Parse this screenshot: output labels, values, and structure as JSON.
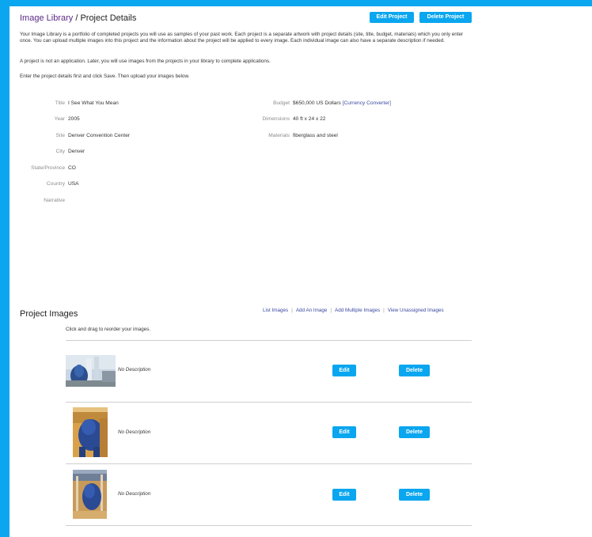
{
  "header": {
    "crumb_link": "Image Library",
    "crumb_sep": " / ",
    "crumb_current": "Project Details",
    "edit_project": "Edit Project",
    "delete_project": "Delete Project"
  },
  "intro": {
    "p1": "Your Image Library is a portfolio of completed projects you will use as samples of your past work. Each project is a separate artwork with project details (site, title, budget, materials) which you only enter once. You can upload multiple images into this project and the information about the project will be applied to every image. Each individual image can also have a separate description if needed.",
    "p2": "A project is not an application. Later, you will use images from the projects in your library to complete applications.",
    "p3": "Enter the project details first and click Save. Then upload your images below."
  },
  "details": {
    "left": [
      {
        "label": "Title",
        "value": "I See What You Mean"
      },
      {
        "label": "Year",
        "value": "2005"
      },
      {
        "label": "Site",
        "value": "Denver Convention Center"
      },
      {
        "label": "City",
        "value": "Denver"
      },
      {
        "label": "State/Province",
        "value": "CO"
      },
      {
        "label": "Country",
        "value": "USA"
      },
      {
        "label": "Narrative",
        "value": ""
      }
    ],
    "right": [
      {
        "label": "Budget",
        "value": "$650,000 US Dollars",
        "link": "[Currency Converter]"
      },
      {
        "label": "Dimensions",
        "value": "40 ft x 24 x 22"
      },
      {
        "label": "Materials",
        "value": "fiberglass and steel"
      }
    ]
  },
  "images_section": {
    "title": "Project Images",
    "links": [
      "List Images",
      "Add An Image",
      "Add Multiple Images",
      "View Unassigned Images"
    ],
    "hint": "Click and drag to reorder your images.",
    "rows": [
      {
        "description": "No Description",
        "edit": "Edit",
        "delete": "Delete"
      },
      {
        "description": "No Description",
        "edit": "Edit",
        "delete": "Delete"
      },
      {
        "description": "No Description",
        "edit": "Edit",
        "delete": "Delete"
      }
    ]
  },
  "colors": {
    "accent": "#0aa6ef",
    "breadcrumb_link": "#5b2a86",
    "link": "#3a4aa0"
  }
}
